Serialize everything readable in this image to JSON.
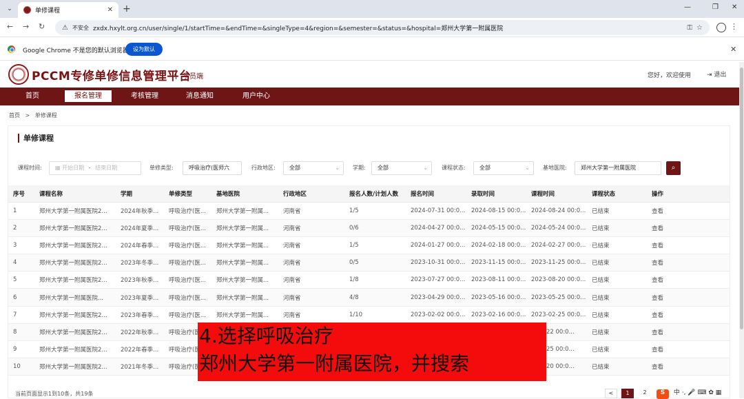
{
  "browser": {
    "tab_title": "单修课程",
    "security_label": "不安全",
    "url": "zxdx.hxylt.org.cn/user/single/1/startTime=&endTime=&singleType=4&region=&semester=&status=&hospital=郑州大学第一附属医院",
    "infobar_message": "Google Chrome 不是您的默认浏览器",
    "infobar_button": "设为默认"
  },
  "site": {
    "title": "PCCM专修单修信息管理平台",
    "subtitle": "学员端",
    "greeting": "您好，欢迎使用",
    "logout": "退出"
  },
  "nav": {
    "items": [
      "首页",
      "报名管理",
      "考核管理",
      "消息通知",
      "用户中心"
    ],
    "active": "报名管理"
  },
  "breadcrumb": {
    "home": "首页",
    "sep": ">",
    "current": "单修课程"
  },
  "page_title": "单修课程",
  "filters": {
    "course_time_label": "课程时间:",
    "start_placeholder": "开始日期",
    "range_sep": "-",
    "end_placeholder": "结束日期",
    "type_label": "单修类型:",
    "type_value": "呼吸治疗(医师六",
    "region_label": "行政地区:",
    "region_value": "全部",
    "semester_label": "学期:",
    "semester_value": "全部",
    "status_label": "课程状态:",
    "status_value": "全部",
    "hospital_label": "基地医院:",
    "hospital_value": "郑州大学第一附属医院"
  },
  "table": {
    "headers": [
      "序号",
      "课程名称",
      "学期",
      "单修类型",
      "基地医院",
      "行政地区",
      "报名人数/计划人数",
      "报名时间",
      "录取时间",
      "课程时间",
      "课程状态",
      "操作"
    ],
    "rows": [
      [
        "1",
        "郑州大学第一附属医院2...",
        "2024年秋季...",
        "呼吸治疗(医...",
        "郑州大学第一附属...",
        "河南省",
        "1/5",
        "2024-07-31 00:0...",
        "2024-08-15 00:0...",
        "2024-08-24 00:0...",
        "已结束",
        "查看"
      ],
      [
        "2",
        "郑州大学第一附属医院2...",
        "2024年夏季...",
        "呼吸治疗(医...",
        "郑州大学第一附属...",
        "河南省",
        "0/6",
        "2024-04-27 00:0...",
        "2024-05-15 00:0...",
        "2024-05-24 00:0...",
        "已结束",
        "查看"
      ],
      [
        "3",
        "郑州大学第一附属医院2...",
        "2024年春季...",
        "呼吸治疗(医...",
        "郑州大学第一附属...",
        "河南省",
        "1/5",
        "2024-01-27 00:0...",
        "2024-02-18 00:0...",
        "2024-02-27 00:0...",
        "已结束",
        "查看"
      ],
      [
        "4",
        "郑州大学第一附属医院2...",
        "2023年冬季...",
        "呼吸治疗(医...",
        "郑州大学第一附属...",
        "河南省",
        "0/5",
        "2023-10-31 00:0...",
        "2023-11-15 00:0...",
        "2023-11-25 00:0...",
        "已结束",
        "查看"
      ],
      [
        "5",
        "郑州大学第一附属医院2...",
        "2023年秋季...",
        "呼吸治疗(医...",
        "郑州大学第一附属...",
        "河南省",
        "1/8",
        "2023-07-27 00:0...",
        "2023-08-11 00:0...",
        "2023-08-20 00:0...",
        "已结束",
        "查看"
      ],
      [
        "6",
        "郑州大学第一附属医院...",
        "2023年夏季...",
        "呼吸治疗(医...",
        "郑州大学第一附属...",
        "河南省",
        "4/8",
        "2023-04-29 00:0...",
        "2023-05-16 00:0...",
        "2023-05-25 00:0...",
        "已结束",
        "查看"
      ],
      [
        "7",
        "郑州大学第一附属医院2...",
        "2023年春季...",
        "呼吸治疗(医...",
        "郑州大学第一附属...",
        "河南省",
        "1/10",
        "2023-02-02 00:0...",
        "2023-02-16 00:0...",
        "2023-02-25 00:0...",
        "已结束",
        "查看"
      ],
      [
        "8",
        "郑州大学第一附属医院2...",
        "2022年秋季...",
        "呼吸治疗(医...",
        "",
        "",
        "",
        "",
        "",
        "...08-22 00:0...",
        "已结束",
        "查看"
      ],
      [
        "9",
        "郑州大学第一附属医院2...",
        "2022年春季...",
        "呼吸治疗(医...",
        "",
        "",
        "",
        "",
        "",
        "...02-25 00:0...",
        "已结束",
        "查看"
      ],
      [
        "10",
        "郑州大学第一附属医院2...",
        "2021年冬季...",
        "呼吸治疗(医...",
        "",
        "",
        "",
        "",
        "",
        "...11-20 00:0...",
        "已结束",
        "查看"
      ]
    ]
  },
  "overlay": {
    "line1": "4.选择呼吸治疗",
    "line2": "郑州大学第一附属医院，并搜索"
  },
  "footer": {
    "summary": "当前页面显示1到10条，共19条",
    "pages": [
      "1",
      "2"
    ],
    "prev": "<"
  },
  "tray": {
    "sogou": "S",
    "lang": "中"
  }
}
